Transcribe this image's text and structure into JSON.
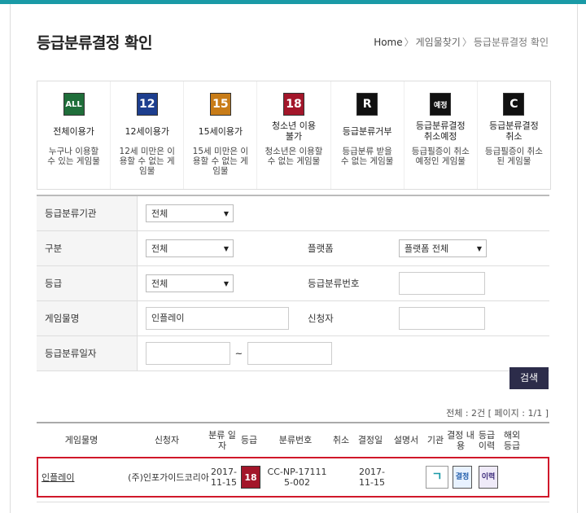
{
  "header": {
    "title": "등급분류결정 확인",
    "breadcrumb": [
      "Home",
      "게임물찾기",
      "등급분류결정 확인"
    ],
    "separator": "〉"
  },
  "ratings": [
    {
      "icon": "ALL",
      "icon_color": "#1f6e3a",
      "name": "전체이용가",
      "desc": "누구나 이용할 수 있는 게임물"
    },
    {
      "icon": "12",
      "icon_color": "#1d3e8e",
      "name": "12세이용가",
      "desc": "12세 미만은 이용할 수 없는 게임물"
    },
    {
      "icon": "15",
      "icon_color": "#c87c18",
      "name": "15세이용가",
      "desc": "15세 미만은 이용할 수 없는 게임물"
    },
    {
      "icon": "18",
      "icon_color": "#a3162a",
      "name": "청소년 이용불가",
      "desc": "청소년은 이용할 수 없는 게임물"
    },
    {
      "icon": "R",
      "icon_color": "#111111",
      "name": "등급분류거부",
      "desc": "등급분류 받을 수 없는 게임물"
    },
    {
      "icon": "예정",
      "icon_color": "#111111",
      "name": "등급분류결정 취소예정",
      "desc": "등급필증이 취소예정인 게임물"
    },
    {
      "icon": "C",
      "icon_color": "#111111",
      "name": "등급분류결정 취소",
      "desc": "등급필증이 취소된 게임물"
    }
  ],
  "search": {
    "agency_label": "등급분류기관",
    "agency_value": "전체",
    "division_label": "구분",
    "division_value": "전체",
    "platform_label": "플랫폼",
    "platform_value": "플랫폼 전체",
    "grade_label": "등급",
    "grade_value": "전체",
    "number_label": "등급분류번호",
    "number_value": "",
    "game_label": "게임물명",
    "game_value": "인플레이",
    "applicant_label": "신청자",
    "applicant_value": "",
    "date_label": "등급분류일자",
    "date_from": "",
    "date_to": "",
    "tilde": "~",
    "search_button": "검색"
  },
  "result_count": "전체 : 2건 [ 페이지 : 1/1 ]",
  "table": {
    "headers": [
      "게임물명",
      "신청자",
      "분류 일자",
      "등급",
      "분류번호",
      "취소",
      "결정일",
      "설명서",
      "기관",
      "결정 내용",
      "등급 이력",
      "해외 등급"
    ],
    "rows": [
      {
        "game": "인플레이",
        "applicant": "(주)인포가이드코리아",
        "date": "2017-11-15",
        "grade_icon": "18",
        "number": "CC-NP-171115-002",
        "cancel": "",
        "decision_date": "2017-11-15",
        "manual": "",
        "agency_icon": "ㄱ",
        "decision_icon": "결정",
        "history_icon": "이력",
        "overseas": ""
      }
    ]
  },
  "colors": {
    "accent": "#1a9aa6",
    "highlight": "#d0182a",
    "button": "#2c2c4a"
  }
}
